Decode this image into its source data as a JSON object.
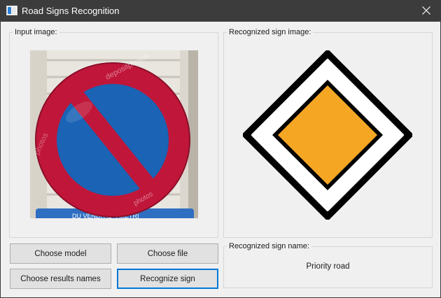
{
  "window": {
    "title": "Road Signs Recognition",
    "app_icon": "window-app-icon",
    "close_icon": "close-icon"
  },
  "input_group": {
    "label": "Input image:",
    "watermark_text": "depositphotos",
    "plate_text": "DU VENDI AU 4 METRI"
  },
  "recognized_group": {
    "label": "Recognized sign image:"
  },
  "name_group": {
    "label": "Recognized sign name:",
    "value": "Priority road"
  },
  "buttons": {
    "choose_model": "Choose model",
    "choose_file": "Choose file",
    "choose_results_names": "Choose results names",
    "recognize_sign": "Recognize sign"
  },
  "colors": {
    "titlebar": "#3c3c3c",
    "focus_border": "#0078d7",
    "priority_fill": "#f5a623",
    "no_parking_red": "#c0163a",
    "no_parking_blue": "#1a63b5"
  }
}
